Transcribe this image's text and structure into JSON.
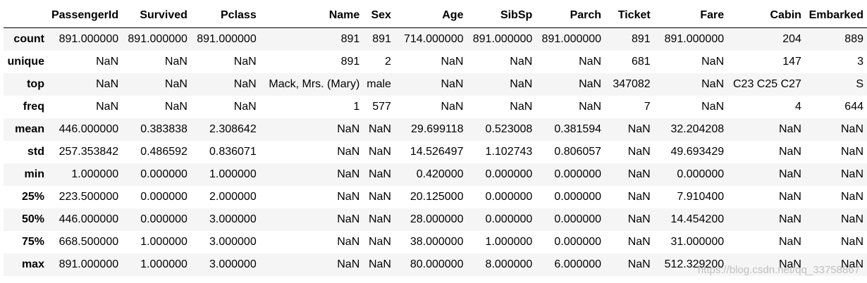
{
  "table": {
    "columns": [
      "PassengerId",
      "Survived",
      "Pclass",
      "Name",
      "Sex",
      "Age",
      "SibSp",
      "Parch",
      "Ticket",
      "Fare",
      "Cabin",
      "Embarked"
    ],
    "rows": [
      {
        "label": "count",
        "cells": [
          "891.000000",
          "891.000000",
          "891.000000",
          "891",
          "891",
          "714.000000",
          "891.000000",
          "891.000000",
          "891",
          "891.000000",
          "204",
          "889"
        ]
      },
      {
        "label": "unique",
        "cells": [
          "NaN",
          "NaN",
          "NaN",
          "891",
          "2",
          "NaN",
          "NaN",
          "NaN",
          "681",
          "NaN",
          "147",
          "3"
        ]
      },
      {
        "label": "top",
        "cells": [
          "NaN",
          "NaN",
          "NaN",
          "Mack, Mrs. (Mary)",
          "male",
          "NaN",
          "NaN",
          "NaN",
          "347082",
          "NaN",
          "C23 C25 C27",
          "S"
        ]
      },
      {
        "label": "freq",
        "cells": [
          "NaN",
          "NaN",
          "NaN",
          "1",
          "577",
          "NaN",
          "NaN",
          "NaN",
          "7",
          "NaN",
          "4",
          "644"
        ]
      },
      {
        "label": "mean",
        "cells": [
          "446.000000",
          "0.383838",
          "2.308642",
          "NaN",
          "NaN",
          "29.699118",
          "0.523008",
          "0.381594",
          "NaN",
          "32.204208",
          "NaN",
          "NaN"
        ]
      },
      {
        "label": "std",
        "cells": [
          "257.353842",
          "0.486592",
          "0.836071",
          "NaN",
          "NaN",
          "14.526497",
          "1.102743",
          "0.806057",
          "NaN",
          "49.693429",
          "NaN",
          "NaN"
        ]
      },
      {
        "label": "min",
        "cells": [
          "1.000000",
          "0.000000",
          "1.000000",
          "NaN",
          "NaN",
          "0.420000",
          "0.000000",
          "0.000000",
          "NaN",
          "0.000000",
          "NaN",
          "NaN"
        ]
      },
      {
        "label": "25%",
        "cells": [
          "223.500000",
          "0.000000",
          "2.000000",
          "NaN",
          "NaN",
          "20.125000",
          "0.000000",
          "0.000000",
          "NaN",
          "7.910400",
          "NaN",
          "NaN"
        ]
      },
      {
        "label": "50%",
        "cells": [
          "446.000000",
          "0.000000",
          "3.000000",
          "NaN",
          "NaN",
          "28.000000",
          "0.000000",
          "0.000000",
          "NaN",
          "14.454200",
          "NaN",
          "NaN"
        ]
      },
      {
        "label": "75%",
        "cells": [
          "668.500000",
          "1.000000",
          "3.000000",
          "NaN",
          "NaN",
          "38.000000",
          "1.000000",
          "0.000000",
          "NaN",
          "31.000000",
          "NaN",
          "NaN"
        ]
      },
      {
        "label": "max",
        "cells": [
          "891.000000",
          "1.000000",
          "3.000000",
          "NaN",
          "NaN",
          "80.000000",
          "8.000000",
          "6.000000",
          "NaN",
          "512.329200",
          "NaN",
          "NaN"
        ]
      }
    ]
  },
  "watermark": "https://blog.csdn.net/qq_33758867"
}
